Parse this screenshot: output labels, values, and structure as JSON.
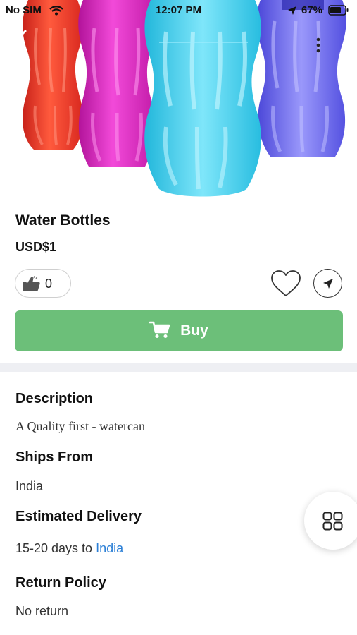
{
  "status_bar": {
    "carrier": "No SIM",
    "time": "12:07 PM",
    "battery": "67%"
  },
  "product": {
    "title": "Water Bottles",
    "price": "USD$1",
    "likes": "0",
    "buy_label": "Buy",
    "bottle_colors": [
      "#f0412d",
      "#e52bc8",
      "#3ed2ef",
      "#6f6cf2"
    ]
  },
  "details": {
    "description_heading": "Description",
    "description_text": "A Quality first - watercan",
    "ships_from_heading": "Ships From",
    "ships_from_value": "India",
    "delivery_heading": "Estimated Delivery",
    "delivery_prefix": "15-20 days to ",
    "delivery_country": "India",
    "return_heading": "Return Policy",
    "return_value": "No return"
  },
  "icons": {
    "back": "chevron-left-icon",
    "more": "more-vertical-icon",
    "like": "thumbs-up-icon",
    "favorite": "heart-icon",
    "share": "send-icon",
    "cart": "cart-icon",
    "fab": "grid-icon"
  },
  "colors": {
    "buy_button": "#6cbf79",
    "link": "#2b7fd6",
    "divider": "#eeeff3"
  }
}
